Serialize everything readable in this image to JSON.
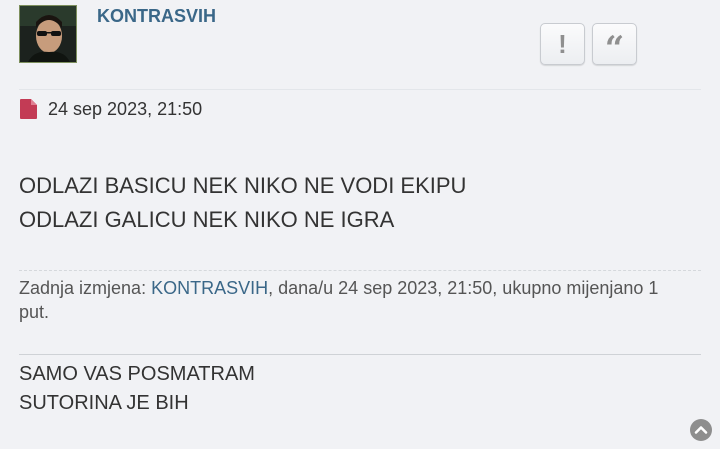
{
  "post": {
    "username": "KONTRASVIH",
    "date": "24 sep 2023, 21:50",
    "content_lines": [
      "ODLAZI BASICU NEK NIKO NE VODI EKIPU",
      "ODLAZI GALICU NEK NIKO NE IGRA"
    ],
    "edit_notice": {
      "prefix": "Zadnja izmjena: ",
      "user": "KONTRASVIH",
      "suffix": ", dana/u 24 sep 2023, 21:50, ukupno mijenjano 1 put."
    },
    "signature_lines": [
      "SAMO VAS POSMATRAM",
      "SUTORINA JE BIH"
    ]
  },
  "buttons": {
    "report_icon": "exclamation-icon",
    "quote_icon": "quote-icon"
  },
  "icons": {
    "post_icon": "file-icon",
    "scroll_icon": "chevron-up-circle-icon"
  },
  "colors": {
    "background": "#f1f2f5",
    "username": "#3a6788",
    "post_icon": "#c33b55"
  }
}
